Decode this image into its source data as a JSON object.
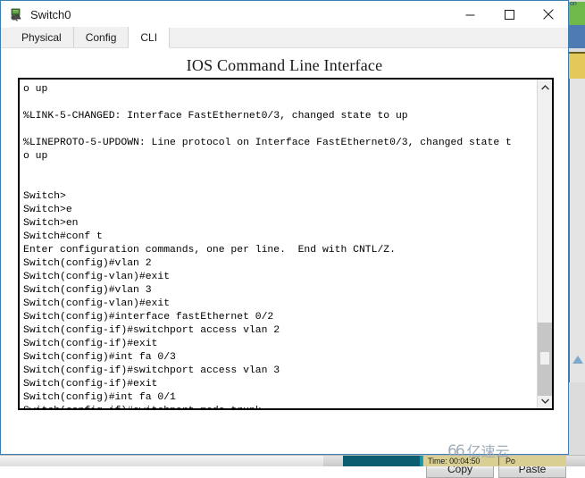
{
  "window": {
    "title": "Switch0",
    "icon": "switch-device-icon",
    "controls": {
      "minimize": "minimize-icon",
      "maximize": "maximize-icon",
      "close": "close-icon"
    }
  },
  "tabs": [
    {
      "label": "Physical",
      "active": false
    },
    {
      "label": "Config",
      "active": false
    },
    {
      "label": "CLI",
      "active": true
    }
  ],
  "panel": {
    "title": "IOS Command Line Interface"
  },
  "terminal": {
    "lines": [
      "o up",
      "",
      "%LINK-5-CHANGED: Interface FastEthernet0/3, changed state to up",
      "",
      "%LINEPROTO-5-UPDOWN: Line protocol on Interface FastEthernet0/3, changed state t",
      "o up",
      "",
      "",
      "Switch>",
      "Switch>e",
      "Switch>en",
      "Switch#conf t",
      "Enter configuration commands, one per line.  End with CNTL/Z.",
      "Switch(config)#vlan 2",
      "Switch(config-vlan)#exit",
      "Switch(config)#vlan 3",
      "Switch(config-vlan)#exit",
      "Switch(config)#interface fastEthernet 0/2",
      "Switch(config-if)#switchport access vlan 2",
      "Switch(config-if)#exit",
      "Switch(config)#int fa 0/3",
      "Switch(config-if)#switchport access vlan 3",
      "Switch(config-if)#exit",
      "Switch(config)#int fa 0/1",
      "Switch(config-if)#switchport mode trunk"
    ],
    "prompt": "Switch(config-if)#",
    "scrollbar": {
      "up_arrow": "chevron-up-icon",
      "down_arrow": "chevron-down-icon"
    }
  },
  "buttons": {
    "copy": "Copy",
    "paste": "Paste"
  },
  "taskbar": {
    "status_time": "Time: 00:04:50",
    "status_extra": "Po"
  },
  "watermark": {
    "glyph": "66",
    "text": "亿速云"
  },
  "background": {
    "corner_text": "on"
  }
}
